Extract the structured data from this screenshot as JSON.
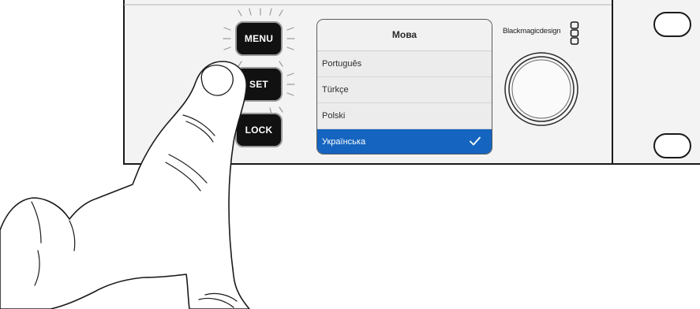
{
  "panel": {
    "buttons": {
      "menu": "MENU",
      "set": "SET",
      "lock": "LOCK"
    },
    "brand": "Blackmagicdesign",
    "brand_logo_icon": "blackmagic-logo-icon",
    "knob_icon": "rotary-knob-icon"
  },
  "lcd": {
    "title": "Мова",
    "items": [
      {
        "label": "Português",
        "selected": false
      },
      {
        "label": "Türkçe",
        "selected": false
      },
      {
        "label": "Polski",
        "selected": false
      },
      {
        "label": "Українська",
        "selected": true
      }
    ],
    "selected_icon": "checkmark-icon",
    "selected_color": "#1565c0"
  },
  "illustration": {
    "hand_icon": "pointing-hand-icon",
    "pressed_button": "set"
  }
}
